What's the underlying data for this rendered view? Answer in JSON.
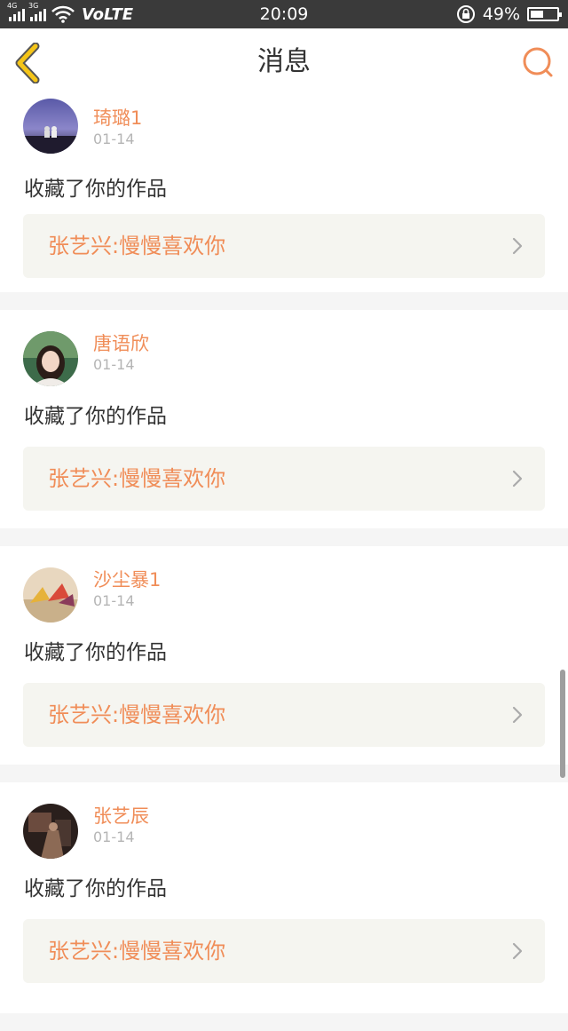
{
  "status_bar": {
    "net_1": "4G",
    "net_2": "3G",
    "volte": "VoLTE",
    "time": "20:09",
    "battery": "49%",
    "battery_level": 0.49
  },
  "header": {
    "title": "消息"
  },
  "messages": [
    {
      "user": "琦璐1",
      "date": "01-14",
      "action": "收藏了你的作品",
      "work": "张艺兴:慢慢喜欢你"
    },
    {
      "user": "唐语欣",
      "date": "01-14",
      "action": "收藏了你的作品",
      "work": "张艺兴:慢慢喜欢你"
    },
    {
      "user": "沙尘暴1",
      "date": "01-14",
      "action": "收藏了你的作品",
      "work": "张艺兴:慢慢喜欢你"
    },
    {
      "user": "张艺辰",
      "date": "01-14",
      "action": "收藏了你的作品",
      "work": "张艺兴:慢慢喜欢你"
    }
  ],
  "colors": {
    "accent": "#f08d58",
    "back_icon": "#f5c518"
  }
}
